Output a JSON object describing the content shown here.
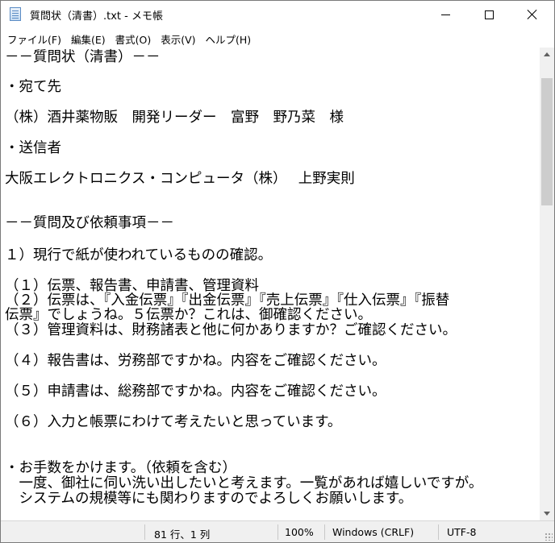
{
  "window": {
    "title": "質問状（清書）.txt - メモ帳",
    "app_icon": "notepad-icon",
    "controls": [
      "minimize-icon",
      "maximize-icon",
      "close-icon"
    ]
  },
  "menu": {
    "items": [
      {
        "label": "ファイル(F)"
      },
      {
        "label": "編集(E)"
      },
      {
        "label": "書式(O)"
      },
      {
        "label": "表示(V)"
      },
      {
        "label": "ヘルプ(H)"
      }
    ]
  },
  "document": {
    "lines": [
      "－－質問状（清書）－－",
      "・宛て先",
      "（株）酒井薬物販　開発リーダー　富野　野乃菜　様",
      "・送信者",
      "大阪エレクトロニクス・コンピュータ（株）　 上野実則",
      "－－質問及び依頼事項－－",
      "１）現行で紙が使われているものの確認。",
      "（１）伝票、報告書、申請書、管理資料",
      "（２）伝票は、『入金伝票』『出金伝票』『売上伝票』『仕入伝票』『振替",
      "伝票』でしょうね。５伝票か？これは、御確認ください。",
      "（３）管理資料は、財務諸表と他に何かありますか？ご確認ください。",
      "（４）報告書は、労務部ですかね。内容をご確認ください。",
      "（５）申請書は、総務部ですかね。内容をご確認ください。",
      "（６）入力と帳票にわけて考えたいと思っています。",
      "・お手数をかけます。（依頼を含む）",
      "　一度、御社に伺い洗い出したいと考えます。一覧があれば嬉しいですが。",
      "　システムの規模等にも関わりますのでよろしくお願いします。"
    ]
  },
  "status": {
    "position": "81 行、1 列",
    "zoom": "100%",
    "line_ending": "Windows (CRLF)",
    "encoding": "UTF-8"
  }
}
